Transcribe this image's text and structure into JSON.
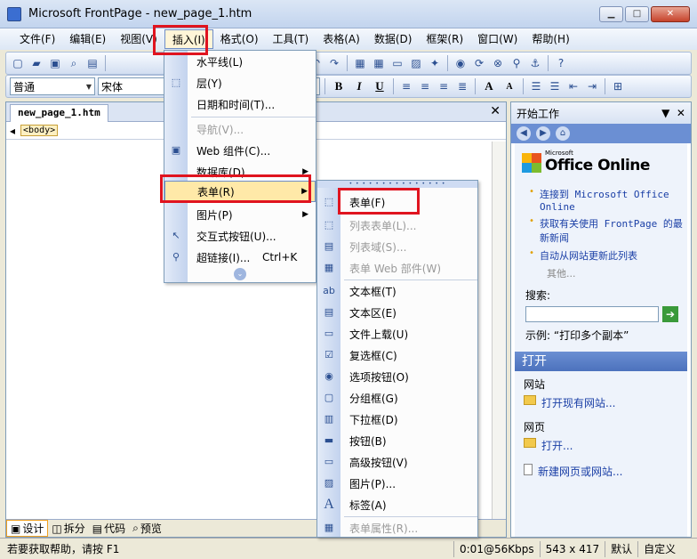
{
  "window": {
    "title": "Microsoft FrontPage - new_page_1.htm"
  },
  "menubar": [
    "文件(F)",
    "编辑(E)",
    "视图(V)",
    "插入(I)",
    "格式(O)",
    "工具(T)",
    "表格(A)",
    "数据(D)",
    "框架(R)",
    "窗口(W)",
    "帮助(H)"
  ],
  "format_toolbar": {
    "style": "普通",
    "font": "宋体",
    "bold": "B",
    "italic": "I",
    "underline": "U",
    "font_grow": "A",
    "font_shrink": "A"
  },
  "document": {
    "tab": "new_page_1.htm",
    "tag": "<body>",
    "view_tabs": [
      "设计",
      "拆分",
      "代码",
      "预览"
    ]
  },
  "insert_menu": {
    "items": [
      {
        "label": "水平线(L)",
        "disabled": false
      },
      {
        "label": "层(Y)",
        "disabled": false
      },
      {
        "label": "日期和时间(T)...",
        "disabled": false
      },
      {
        "label": "导航(V)...",
        "disabled": true
      },
      {
        "label": "Web 组件(C)...",
        "disabled": false
      },
      {
        "label": "数据库(D)",
        "disabled": false
      },
      {
        "label": "表单(R)",
        "disabled": false,
        "highlighted": true
      },
      {
        "label": "图片(P)",
        "disabled": false
      },
      {
        "label": "交互式按钮(U)...",
        "disabled": false
      },
      {
        "label": "超链接(I)...",
        "shortcut": "Ctrl+K",
        "disabled": false
      }
    ]
  },
  "form_submenu": {
    "items": [
      {
        "label": "表单(F)",
        "disabled": false
      },
      {
        "label": "列表表单(L)...",
        "disabled": true
      },
      {
        "label": "列表域(S)...",
        "disabled": true
      },
      {
        "label": "表单 Web 部件(W)",
        "disabled": true
      },
      {
        "label": "文本框(T)",
        "disabled": false
      },
      {
        "label": "文本区(E)",
        "disabled": false
      },
      {
        "label": "文件上载(U)",
        "disabled": false
      },
      {
        "label": "复选框(C)",
        "disabled": false
      },
      {
        "label": "选项按钮(O)",
        "disabled": false
      },
      {
        "label": "分组框(G)",
        "disabled": false
      },
      {
        "label": "下拉框(D)",
        "disabled": false
      },
      {
        "label": "按钮(B)",
        "disabled": false
      },
      {
        "label": "高级按钮(V)",
        "disabled": false
      },
      {
        "label": "图片(P)...",
        "disabled": false
      },
      {
        "label": "标签(A)",
        "disabled": false
      },
      {
        "label": "表单属性(R)...",
        "disabled": true
      }
    ]
  },
  "task_pane": {
    "title": "开始工作",
    "logo_small": "Microsoft",
    "logo_text": "Office Online",
    "links": [
      "连接到 Microsoft Office Online",
      "获取有关使用 FrontPage 的最新新闻",
      "自动从网站更新此列表"
    ],
    "more": "其他...",
    "search_label": "搜索:",
    "example": "示例: “打印多个副本”",
    "open_section": "打开",
    "website_label": "网站",
    "open_website": "打开现有网站...",
    "webpage_label": "网页",
    "open_page": "打开...",
    "new_page": "新建网页或网站..."
  },
  "status": {
    "help": "若要获取帮助，请按 F1",
    "speed": "0:01@56Kbps",
    "size": "543 x 417",
    "default": "默认",
    "custom": "自定义"
  }
}
